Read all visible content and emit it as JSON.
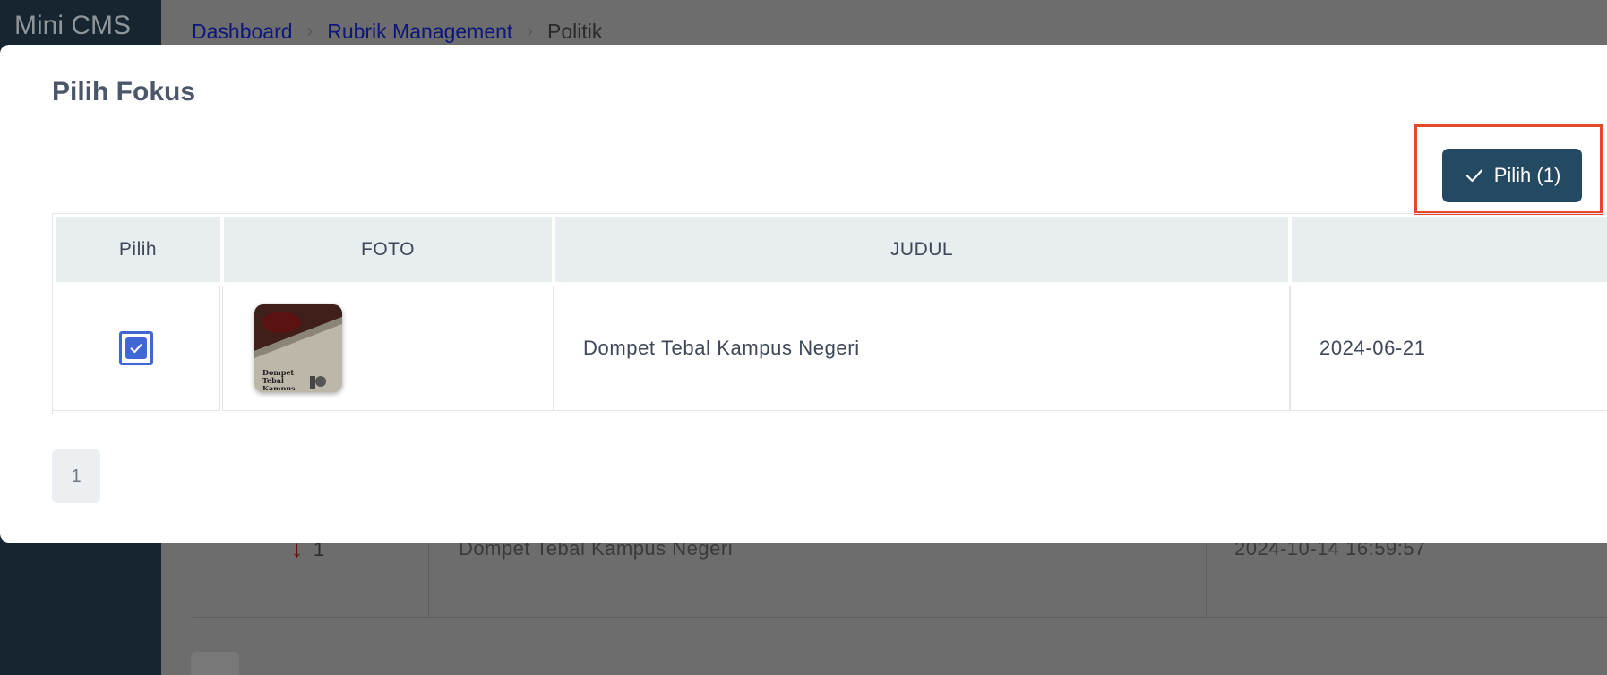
{
  "app": {
    "brand": "Mini CMS"
  },
  "breadcrumb": {
    "items": [
      "Dashboard",
      "Rubrik Management",
      "Politik"
    ]
  },
  "background_table": {
    "rank": "1",
    "title": "Dompet Tebal Kampus Negeri",
    "date": "2024-10-14 16:59:57"
  },
  "modal": {
    "title": "Pilih Fokus",
    "select_button_label": "Pilih (1)",
    "table": {
      "headers": [
        "Pilih",
        "FOTO",
        "JUDUL"
      ],
      "rows": [
        {
          "checked": true,
          "photo_caption": "Dompet Tebal Kampus",
          "title": "Dompet Tebal Kampus Negeri",
          "date": "2024-06-21"
        }
      ]
    },
    "pagination": {
      "current_page": "1"
    }
  },
  "colors": {
    "primary_button": "#244a63",
    "highlight_box": "#e5472b",
    "checkbox": "#3f67d6",
    "sidebar": "#16252f"
  }
}
